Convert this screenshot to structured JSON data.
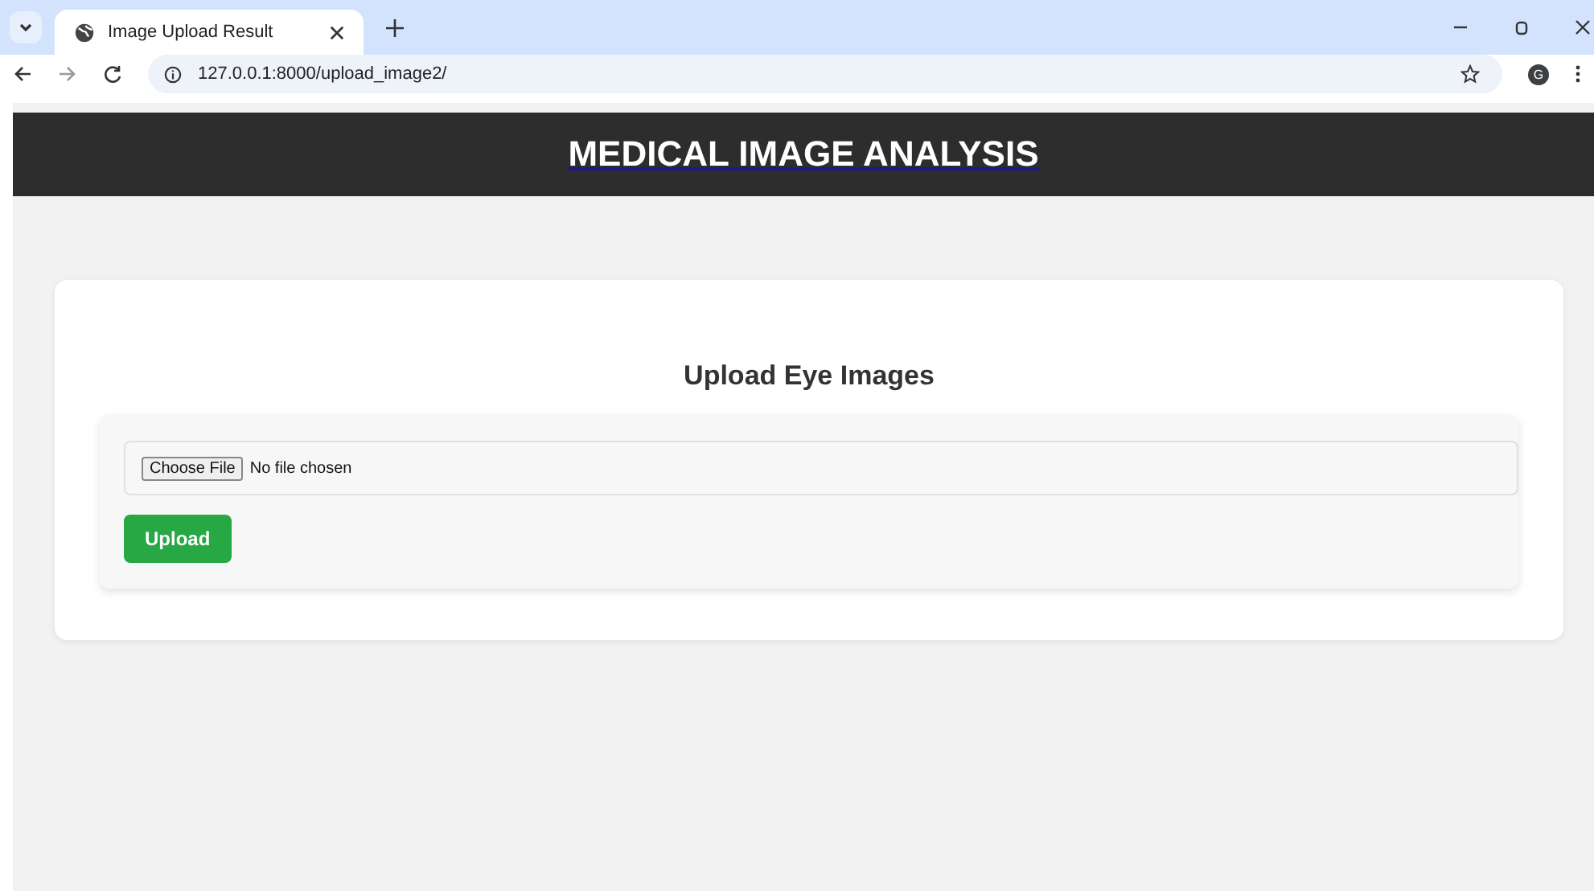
{
  "browser": {
    "tab_title": "Image Upload Result",
    "url": "127.0.0.1:8000/upload_image2/",
    "profile_initial": "G"
  },
  "header": {
    "title": "MEDICAL IMAGE ANALYSIS"
  },
  "form": {
    "heading": "Upload Eye Images",
    "file_button": "Choose File",
    "file_status": "No file chosen",
    "submit": "Upload"
  }
}
